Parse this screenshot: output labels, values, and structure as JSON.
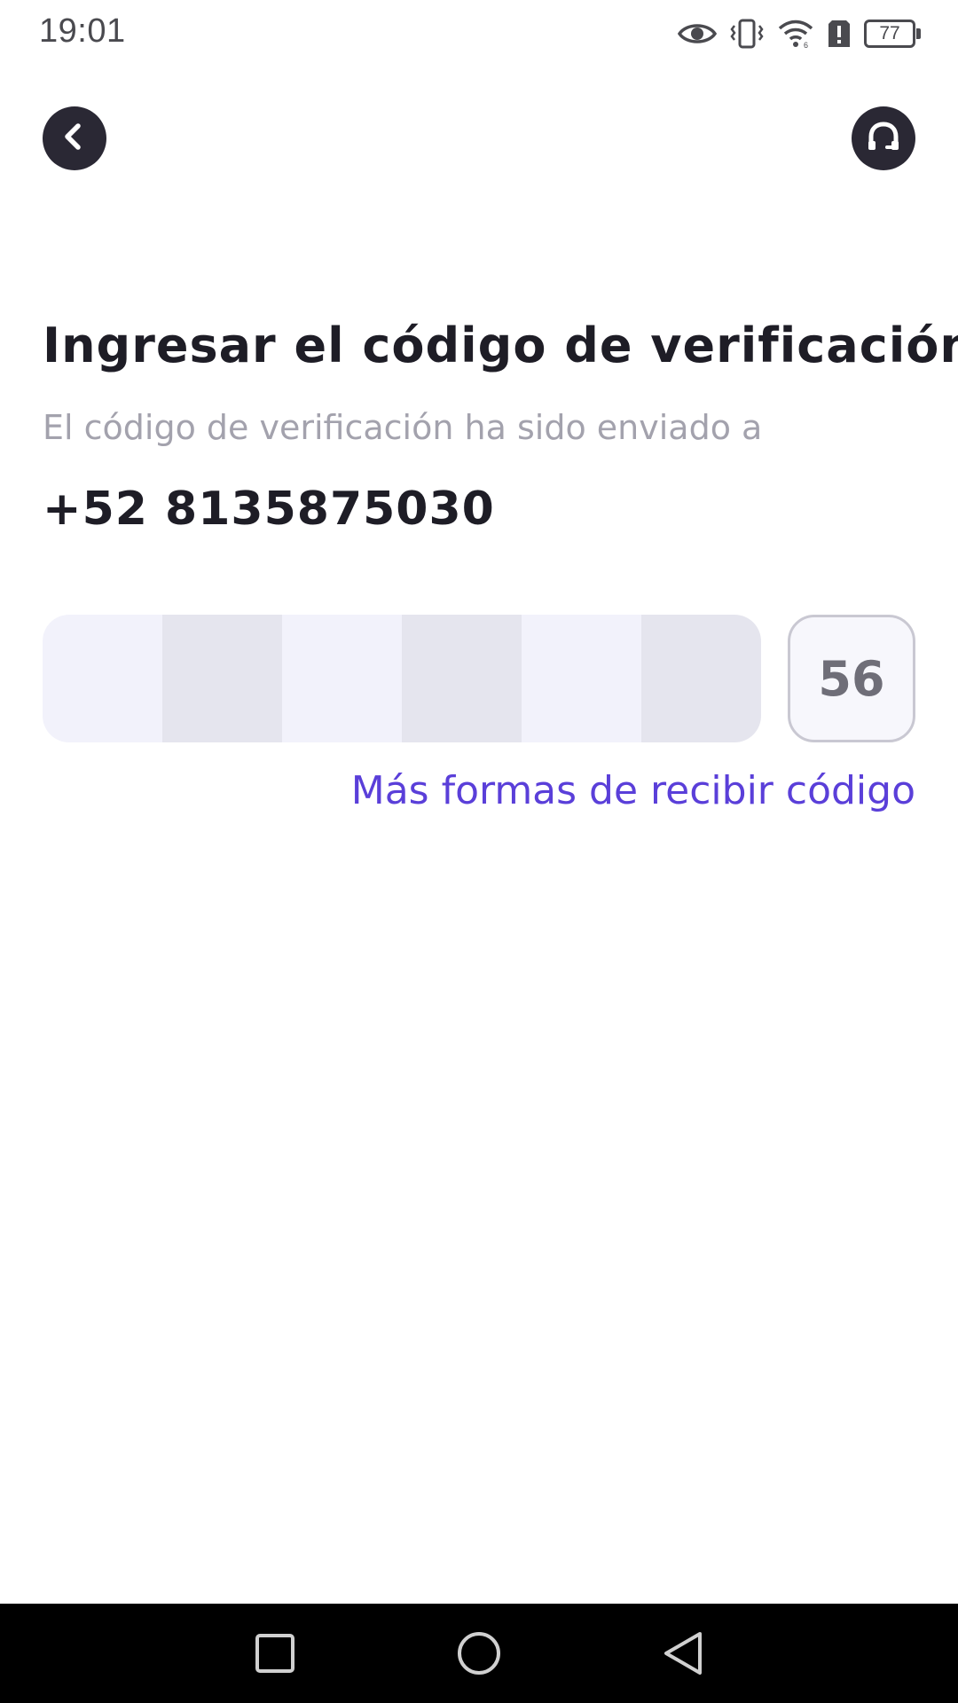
{
  "status_bar": {
    "time": "19:01",
    "battery_level": "77",
    "icons": [
      "eye-icon",
      "vibrate-icon",
      "wifi-icon",
      "alert-icon",
      "battery-icon"
    ]
  },
  "header": {
    "back_icon": "chevron-left-icon",
    "support_icon": "headset-icon"
  },
  "content": {
    "title": "Ingresar el código de verificación",
    "subtitle": "El código de verificación ha sido enviado a",
    "phone": "+52 8135875030",
    "code_length": 6,
    "countdown": "56",
    "more_ways_link": "Más formas de recibir código"
  },
  "colors": {
    "accent": "#5a3fd9",
    "dark": "#2a2834",
    "muted": "#a3a2ad",
    "cell_light": "#f2f2fb",
    "cell_dark": "#e5e5ee"
  },
  "nav_bar": {
    "buttons": [
      "recents-button",
      "home-button",
      "back-button"
    ]
  }
}
